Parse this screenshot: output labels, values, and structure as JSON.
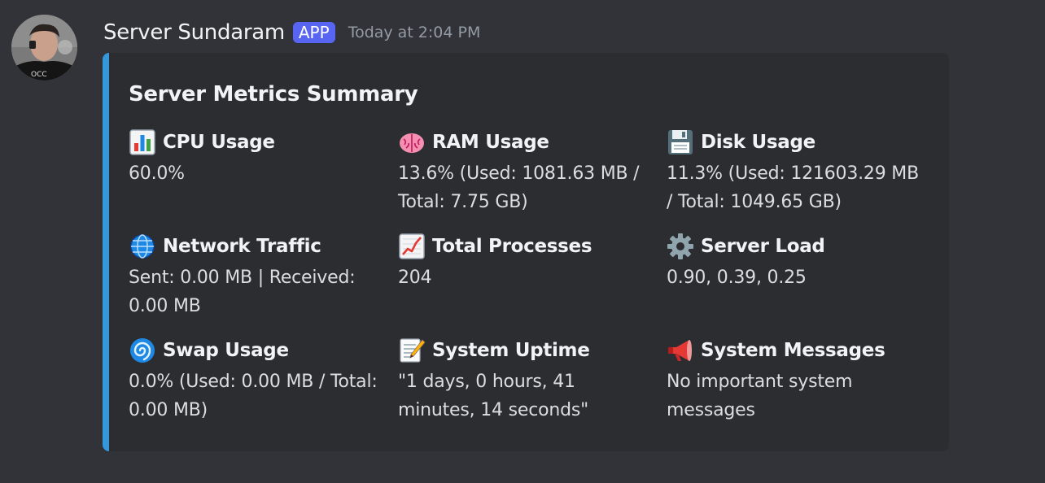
{
  "message": {
    "username": "Server Sundaram",
    "badge": "APP",
    "timestamp": "Today at 2:04 PM",
    "avatar_icon": "user-avatar-photo"
  },
  "embed": {
    "accent_color": "#3498db",
    "title": "Server Metrics Summary",
    "fields": [
      {
        "icon": "bar-chart-icon",
        "name": "CPU Usage",
        "value": "60.0%"
      },
      {
        "icon": "brain-icon",
        "name": "RAM Usage",
        "value": "13.6% (Used: 1081.63 MB / Total: 7.75 GB)"
      },
      {
        "icon": "floppy-disk-icon",
        "name": "Disk Usage",
        "value": "11.3% (Used: 121603.29 MB / Total: 1049.65 GB)"
      },
      {
        "icon": "globe-icon",
        "name": "Network Traffic",
        "value": "Sent: 0.00 MB | Received: 0.00 MB"
      },
      {
        "icon": "trending-up-chart-icon",
        "name": "Total Processes",
        "value": "204"
      },
      {
        "icon": "gear-icon",
        "name": "Server Load",
        "value": "0.90, 0.39, 0.25"
      },
      {
        "icon": "cyclone-icon",
        "name": "Swap Usage",
        "value": "0.0% (Used: 0.00 MB / Total: 0.00 MB)"
      },
      {
        "icon": "memo-icon",
        "name": "System Uptime",
        "value": "\"1 days, 0 hours, 41 minutes, 14 seconds\""
      },
      {
        "icon": "megaphone-icon",
        "name": "System Messages",
        "value": "No important system messages"
      }
    ]
  },
  "colors": {
    "background": "#313338",
    "embed_background": "#2b2d31",
    "badge": "#5865f2",
    "timestamp": "#949ba4"
  }
}
